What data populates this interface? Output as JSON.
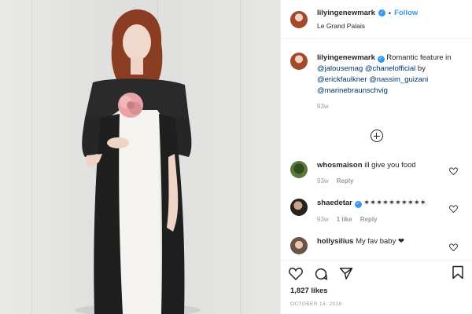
{
  "post": {
    "username": "lilyingenewmark",
    "follow_label": "Follow",
    "location": "Le Grand Palais",
    "separator": "•"
  },
  "caption": {
    "username": "lilyingenewmark",
    "text_prefix": "Romantic feature in",
    "mention1": "@jalousemag",
    "mention2": "@chanelofficial",
    "by": "by",
    "mention3": "@erickfaulkner",
    "mention4": "@nassim_guizani",
    "mention5": "@marinebraunschvig",
    "age": "93w"
  },
  "comments": [
    {
      "username": "whosmaison",
      "text": "ill give you food",
      "age": "93w",
      "likes": "",
      "reply": "Reply"
    },
    {
      "username": "shaedetar",
      "text": "✶✶✶✶✶✶✶✶✶✶",
      "age": "93w",
      "likes": "1 like",
      "reply": "Reply"
    },
    {
      "username": "hollysilius",
      "text": "My fav baby ❤",
      "age": "",
      "likes": "",
      "reply": ""
    }
  ],
  "likes": "1,827 likes",
  "date": "OCTOBER 14, 2018",
  "icons": {
    "like": "heart-icon",
    "comment": "comment-icon",
    "share": "share-icon",
    "save": "bookmark-icon",
    "load_more": "plus-circle-icon",
    "verified": "verified-badge-icon"
  },
  "colors": {
    "link": "#3897f0",
    "mention": "#003569",
    "muted": "#999999"
  }
}
